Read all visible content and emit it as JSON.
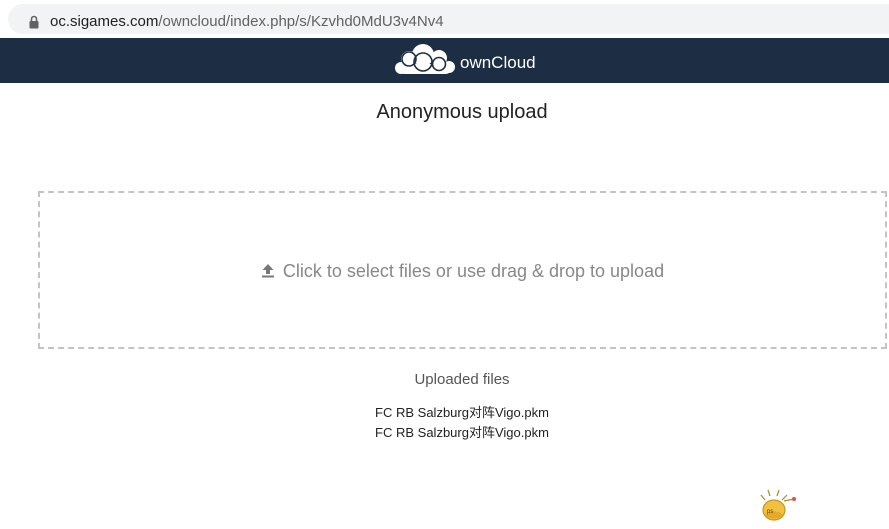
{
  "browser": {
    "url_host": "oc.sigames.com",
    "url_path": "/owncloud/index.php/s/Kzvhd0MdU3v4Nv4",
    "lock_icon": "lock-icon"
  },
  "header": {
    "brand_name": "ownCloud",
    "logo_icon": "cloud-logo-icon",
    "background": "#1d2d44"
  },
  "main": {
    "title": "Anonymous upload",
    "dropzone": {
      "icon": "upload-icon",
      "text": "Click to select files or use drag & drop to upload"
    },
    "uploaded": {
      "heading": "Uploaded files",
      "files": [
        "FC RB Salzburg对阵Vigo.pkm",
        "FC RB Salzburg对阵Vigo.pkm"
      ]
    }
  },
  "mascot_icon": "tips-mascot-icon",
  "colors": {
    "header_bg": "#1d2d44",
    "dropzone_border": "#c4c4c4",
    "dropzone_text": "#888888"
  }
}
